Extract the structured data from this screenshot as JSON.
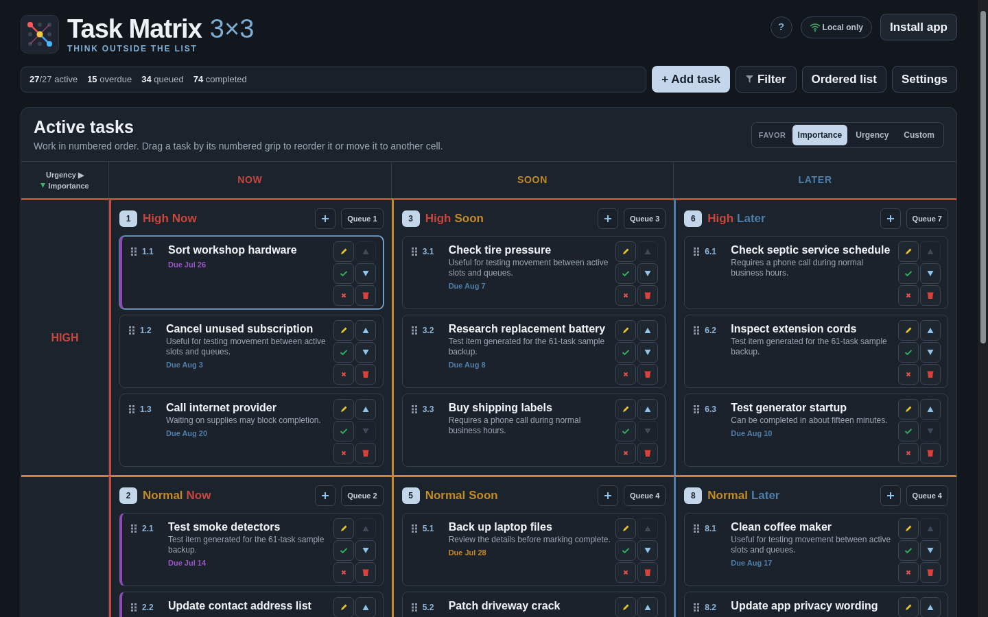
{
  "header": {
    "title": "Task Matrix",
    "title_accent": "3×3",
    "tagline": "THINK OUTSIDE THE LIST",
    "help": "?",
    "connection": "Local only",
    "install": "Install app"
  },
  "stats": [
    "**27**/27 active",
    "**15** overdue",
    "**34** queued",
    "**74** completed"
  ],
  "toolbar": [
    {
      "kind": "primary",
      "label": "+ Add task"
    },
    {
      "kind": "filter",
      "label": "Filter"
    },
    {
      "kind": "plain",
      "label": "Ordered list"
    },
    {
      "kind": "plain",
      "label": "Settings"
    }
  ],
  "panel": {
    "title": "Active tasks",
    "subtitle": "Work in numbered order. Drag a task by its numbered grip to reorder it or move it to another cell.",
    "favor": {
      "label": "FAVOR",
      "options": [
        {
          "label": "Importance",
          "selected": true
        },
        {
          "label": "Urgency",
          "selected": false
        },
        {
          "label": "Custom",
          "selected": false
        }
      ]
    }
  },
  "matrix": {
    "corner": {
      "x_axis": "Urgency ▶",
      "y_axis": "Importance"
    },
    "columns": [
      {
        "label": "NOW",
        "color": "#c9463d"
      },
      {
        "label": "SOON",
        "color": "#c48a24"
      },
      {
        "label": "LATER",
        "color": "#4f7fa8"
      }
    ],
    "rows": [
      {
        "label": "HIGH",
        "color": "#c9463d",
        "cells": [
          {
            "number": "1",
            "importance": "High",
            "urgency": "Now",
            "queue": "Queue 1",
            "tasks": [
              {
                "number": "1.1",
                "title": "Sort workshop hardware",
                "due": "Due Jul 26",
                "overdue": true,
                "due_soon": false,
                "selected": true,
                "can_move_up": false,
                "can_move_down": true
              },
              {
                "number": "1.2",
                "title": "Cancel unused subscription",
                "note": "Useful for testing movement between active slots and queues.",
                "due": "Due Aug 3",
                "overdue": false,
                "due_soon": false,
                "selected": false,
                "can_move_up": true,
                "can_move_down": true
              },
              {
                "number": "1.3",
                "title": "Call internet provider",
                "note": "Waiting on supplies may block completion.",
                "due": "Due Aug 20",
                "overdue": false,
                "due_soon": false,
                "selected": false,
                "can_move_up": true,
                "can_move_down": false
              }
            ]
          },
          {
            "number": "3",
            "importance": "High",
            "urgency": "Soon",
            "queue": "Queue 3",
            "tasks": [
              {
                "number": "3.1",
                "title": "Check tire pressure",
                "note": "Useful for testing movement between active slots and queues.",
                "due": "Due Aug 7",
                "overdue": false,
                "due_soon": false,
                "selected": false,
                "can_move_up": false,
                "can_move_down": true
              },
              {
                "number": "3.2",
                "title": "Research replacement battery",
                "note": "Test item generated for the 61-task sample backup.",
                "due": "Due Aug 8",
                "overdue": false,
                "due_soon": false,
                "selected": false,
                "can_move_up": true,
                "can_move_down": true
              },
              {
                "number": "3.3",
                "title": "Buy shipping labels",
                "note": "Requires a phone call during normal business hours.",
                "overdue": false,
                "selected": false,
                "can_move_up": true,
                "can_move_down": false
              }
            ]
          },
          {
            "number": "6",
            "importance": "High",
            "urgency": "Later",
            "queue": "Queue 7",
            "tasks": [
              {
                "number": "6.1",
                "title": "Check septic service schedule",
                "note": "Requires a phone call during normal business hours.",
                "overdue": false,
                "selected": false,
                "can_move_up": false,
                "can_move_down": true
              },
              {
                "number": "6.2",
                "title": "Inspect extension cords",
                "note": "Test item generated for the 61-task sample backup.",
                "overdue": false,
                "selected": false,
                "can_move_up": true,
                "can_move_down": true
              },
              {
                "number": "6.3",
                "title": "Test generator startup",
                "note": "Can be completed in about fifteen minutes.",
                "due": "Due Aug 10",
                "overdue": false,
                "due_soon": false,
                "selected": false,
                "can_move_up": true,
                "can_move_down": false
              }
            ]
          }
        ]
      },
      {
        "color": "#c48a24",
        "cells": [
          {
            "number": "2",
            "importance": "Normal",
            "urgency": "Now",
            "queue": "Queue 2",
            "tasks": [
              {
                "number": "2.1",
                "title": "Test smoke detectors",
                "note": "Test item generated for the 61-task sample backup.",
                "due": "Due Jul 14",
                "overdue": true,
                "due_soon": false,
                "selected": false,
                "can_move_up": false,
                "can_move_down": true
              },
              {
                "number": "2.2",
                "title": "Update contact address list",
                "overdue": true,
                "selected": false,
                "can_move_up": true
              }
            ]
          },
          {
            "number": "5",
            "importance": "Normal",
            "urgency": "Soon",
            "queue": "Queue 4",
            "tasks": [
              {
                "number": "5.1",
                "title": "Back up laptop files",
                "note": "Review the details before marking complete.",
                "due": "Due Jul 28",
                "overdue": false,
                "due_soon": true,
                "selected": false,
                "can_move_up": false,
                "can_move_down": true
              },
              {
                "number": "5.2",
                "title": "Patch driveway crack",
                "overdue": false,
                "selected": false,
                "can_move_up": true
              }
            ]
          },
          {
            "number": "8",
            "importance": "Normal",
            "urgency": "Later",
            "queue": "Queue 4",
            "tasks": [
              {
                "number": "8.1",
                "title": "Clean coffee maker",
                "note": "Useful for testing movement between active slots and queues.",
                "due": "Due Aug 17",
                "overdue": false,
                "due_soon": false,
                "selected": false,
                "can_move_up": false,
                "can_move_down": true
              },
              {
                "number": "8.2",
                "title": "Update app privacy wording",
                "overdue": false,
                "selected": false,
                "can_move_up": true
              }
            ]
          }
        ]
      }
    ]
  }
}
